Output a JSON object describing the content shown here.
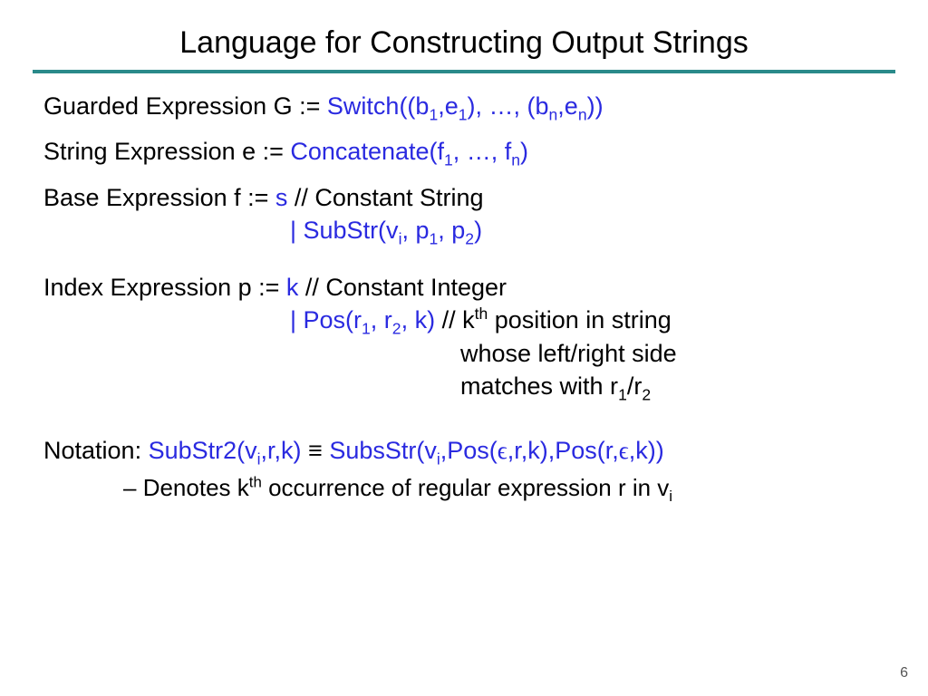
{
  "title": "Language for Constructing Output Strings",
  "guarded": {
    "lhs": "Guarded Expression G  := ",
    "rhs_a": "Switch((b",
    "rhs_b": ",e",
    "rhs_c": "), …, (b",
    "rhs_d": ",e",
    "rhs_e": "))"
  },
  "stringexpr": {
    "lhs": "String Expression e  := ",
    "rhs_a": "Concatenate(f",
    "rhs_b": ", …, f",
    "rhs_c": ")"
  },
  "baseexpr": {
    "lhs": "Base Expression f  :=  ",
    "s": "s",
    "comment": "   // Constant String",
    "bar": "| ",
    "substr_a": "SubStr(v",
    "substr_b": ", p",
    "substr_c": ", p",
    "substr_d": ")"
  },
  "indexexpr": {
    "lhs": "Index Expression p  := ",
    "k": "k",
    "comment": "  // Constant Integer",
    "bar": "| ",
    "pos_a": "Pos(r",
    "pos_b": ", r",
    "pos_c": ", k)",
    "note1a": " // k",
    "note1b": " position in string ",
    "note2": "whose left/right side",
    "note3a": "matches with r",
    "note3b": "/r"
  },
  "notation": {
    "label": "Notation: ",
    "lhs_a": "SubStr2(v",
    "lhs_b": ",r,k)",
    "equiv": " ≡ ",
    "rhs_a": "SubsStr(v",
    "rhs_b": ",Pos(",
    "rhs_c": ",r,k),Pos(r,",
    "rhs_d": ",k))",
    "denote_dash": "– ",
    "denote_a": "Denotes k",
    "denote_b": " occurrence of regular expression r in v"
  },
  "sub": {
    "one": "1",
    "two": "2",
    "n": "n",
    "i": "i"
  },
  "sup": {
    "th": "th"
  },
  "eps": "ϵ",
  "pagenum": "6"
}
